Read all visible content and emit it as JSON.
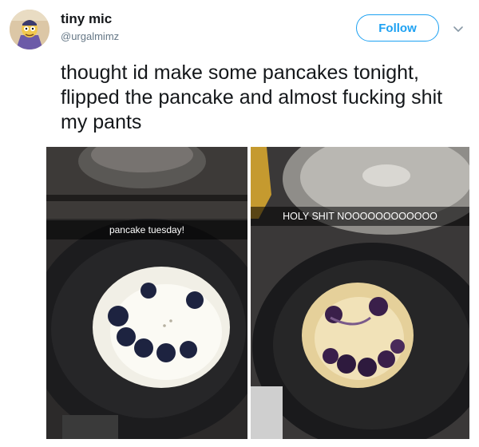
{
  "author": {
    "name": "tiny mic",
    "handle": "@urgalmimz",
    "avatar_icon": "cartoon-avatar"
  },
  "follow_button": {
    "label": "Follow",
    "color": "#1da1f2"
  },
  "menu": {
    "icon": "chevron-down-icon"
  },
  "tweet": {
    "text": "thought id make some pancakes tonight, flipped the pancake and almost fucking shit my pants"
  },
  "media": {
    "left_photo": {
      "caption": "pancake tuesday!"
    },
    "right_photo": {
      "caption": "HOLY SHIT NOOOOOOOOOOOO"
    }
  }
}
